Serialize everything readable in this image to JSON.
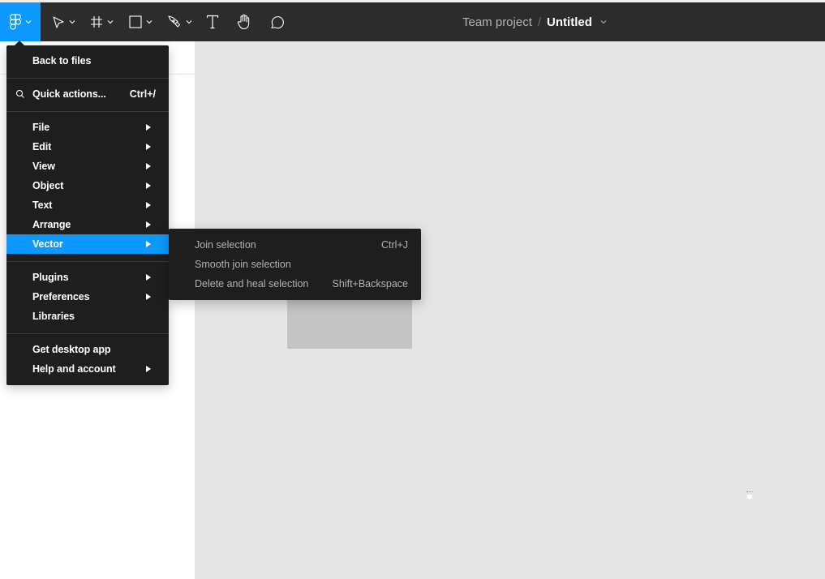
{
  "toolbar": {
    "tools": [
      {
        "name": "main-menu",
        "icon": "figma-logo-icon",
        "has_dropdown": true,
        "active": true
      },
      {
        "name": "move",
        "icon": "cursor-arrow-icon",
        "has_dropdown": true
      },
      {
        "name": "frame",
        "icon": "frame-hash-icon",
        "has_dropdown": true
      },
      {
        "name": "shape",
        "icon": "rectangle-icon",
        "has_dropdown": true
      },
      {
        "name": "pen",
        "icon": "pen-nib-icon",
        "has_dropdown": true
      },
      {
        "name": "text",
        "icon": "text-t-icon",
        "has_dropdown": false
      },
      {
        "name": "hand",
        "icon": "hand-icon",
        "has_dropdown": false
      },
      {
        "name": "comment",
        "icon": "speech-bubble-icon",
        "has_dropdown": false
      }
    ],
    "accent_color": "#0d99ff"
  },
  "breadcrumb": {
    "project": "Team project",
    "separator": "/",
    "file": "Untitled"
  },
  "main_menu": {
    "back": "Back to files",
    "quick_actions": {
      "label": "Quick actions...",
      "shortcut": "Ctrl+/"
    },
    "group1": [
      {
        "label": "File",
        "submenu": true
      },
      {
        "label": "Edit",
        "submenu": true
      },
      {
        "label": "View",
        "submenu": true
      },
      {
        "label": "Object",
        "submenu": true
      },
      {
        "label": "Text",
        "submenu": true
      },
      {
        "label": "Arrange",
        "submenu": true
      },
      {
        "label": "Vector",
        "submenu": true,
        "active": true
      }
    ],
    "group2": [
      {
        "label": "Plugins",
        "submenu": true
      },
      {
        "label": "Preferences",
        "submenu": true
      },
      {
        "label": "Libraries",
        "submenu": false
      }
    ],
    "group3": [
      {
        "label": "Get desktop app",
        "submenu": false
      },
      {
        "label": "Help and account",
        "submenu": true
      }
    ]
  },
  "vector_submenu": [
    {
      "label": "Join selection",
      "shortcut": "Ctrl+J"
    },
    {
      "label": "Smooth join selection",
      "shortcut": ""
    },
    {
      "label": "Delete and heal selection",
      "shortcut": "Shift+Backspace"
    }
  ]
}
